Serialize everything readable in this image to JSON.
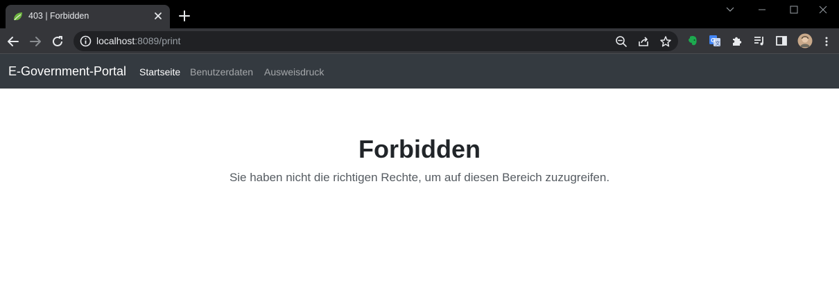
{
  "browser": {
    "tab": {
      "title": "403 | Forbidden",
      "favicon": "spring-leaf-icon"
    },
    "address": {
      "host": "localhost",
      "path": ":8089/print"
    },
    "colors": {
      "titlebar": "#000000",
      "toolbar": "#35363a",
      "omnibox": "#202124"
    }
  },
  "navbar": {
    "brand": "E-Government-Portal",
    "links": [
      {
        "label": "Startseite",
        "active": true
      },
      {
        "label": "Benutzerdaten",
        "active": false
      },
      {
        "label": "Ausweisdruck",
        "active": false
      }
    ],
    "background": "#343a40"
  },
  "main": {
    "heading": "Forbidden",
    "message": "Sie haben nicht die richtigen Rechte, um auf diesen Bereich zuzugreifen."
  }
}
